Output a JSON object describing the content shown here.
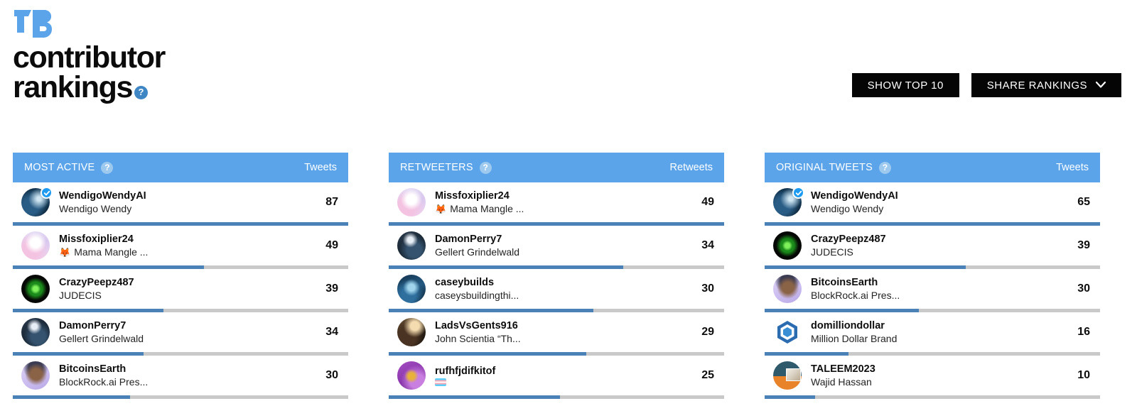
{
  "brand": {
    "logo_alt": "TB logo",
    "line1": "contributor",
    "line2": "rankings",
    "help_label": "?"
  },
  "header": {
    "show_top_button": "SHOW TOP 10",
    "share_button": "SHARE RANKINGS",
    "share_chevron": "⌄"
  },
  "colors": {
    "header_blue": "#5ba4e9",
    "bar_blue": "#4a82b8",
    "bar_track": "#c9c9c9",
    "button_black": "#050505",
    "verified_blue": "#1d9bf0",
    "brand_blue": "#5ba4e9"
  },
  "columns": [
    {
      "title": "MOST ACTIVE",
      "help_label": "?",
      "metric_label": "Tweets",
      "rows": [
        {
          "handle": "WendigoWendyAI",
          "display": "Wendigo Wendy",
          "count": "87",
          "pct": 100,
          "verified": true,
          "avatar": "av-wendigo",
          "emoji": ""
        },
        {
          "handle": "Missfoxiplier24",
          "display": "Mama Mangle ...",
          "count": "49",
          "pct": 57,
          "verified": false,
          "avatar": "av-missfox",
          "emoji": "🦊"
        },
        {
          "handle": "CrazyPeepz487",
          "display": "JUDECIS",
          "count": "39",
          "pct": 45,
          "verified": false,
          "avatar": "av-crazy",
          "emoji": ""
        },
        {
          "handle": "DamonPerry7",
          "display": "Gellert Grindelwald",
          "count": "34",
          "pct": 39,
          "verified": false,
          "avatar": "av-damon",
          "emoji": ""
        },
        {
          "handle": "BitcoinsEarth",
          "display": "BlockRock.ai Pres...",
          "count": "30",
          "pct": 35,
          "verified": false,
          "avatar": "av-bitcoins",
          "emoji": ""
        }
      ]
    },
    {
      "title": "RETWEETERS",
      "help_label": "?",
      "metric_label": "Retweets",
      "rows": [
        {
          "handle": "Missfoxiplier24",
          "display": "Mama Mangle ...",
          "count": "49",
          "pct": 100,
          "verified": false,
          "avatar": "av-missfox",
          "emoji": "🦊"
        },
        {
          "handle": "DamonPerry7",
          "display": "Gellert Grindelwald",
          "count": "34",
          "pct": 70,
          "verified": false,
          "avatar": "av-damon",
          "emoji": ""
        },
        {
          "handle": "caseybuilds",
          "display": "caseysbuildingthi...",
          "count": "30",
          "pct": 61,
          "verified": false,
          "avatar": "av-casey",
          "emoji": ""
        },
        {
          "handle": "LadsVsGents916",
          "display": "John Scientia “Th...",
          "count": "29",
          "pct": 59,
          "verified": false,
          "avatar": "av-lads",
          "emoji": ""
        },
        {
          "handle": "rufhfjdifkitof",
          "display": "",
          "count": "25",
          "pct": 51,
          "verified": false,
          "avatar": "av-rufh",
          "emoji": "flag"
        }
      ]
    },
    {
      "title": "ORIGINAL TWEETS",
      "help_label": "?",
      "metric_label": "Tweets",
      "rows": [
        {
          "handle": "WendigoWendyAI",
          "display": "Wendigo Wendy",
          "count": "65",
          "pct": 100,
          "verified": true,
          "avatar": "av-wendigo",
          "emoji": ""
        },
        {
          "handle": "CrazyPeepz487",
          "display": "JUDECIS",
          "count": "39",
          "pct": 60,
          "verified": false,
          "avatar": "av-crazy",
          "emoji": ""
        },
        {
          "handle": "BitcoinsEarth",
          "display": "BlockRock.ai Pres...",
          "count": "30",
          "pct": 46,
          "verified": false,
          "avatar": "av-bitcoins",
          "emoji": ""
        },
        {
          "handle": "domilliondollar",
          "display": "Million Dollar Brand",
          "count": "16",
          "pct": 25,
          "verified": false,
          "avatar": "av-domillion",
          "emoji": ""
        },
        {
          "handle": "TALEEM2023",
          "display": "Wajid Hassan",
          "count": "10",
          "pct": 15,
          "verified": false,
          "avatar": "av-taleem",
          "emoji": ""
        }
      ]
    }
  ]
}
